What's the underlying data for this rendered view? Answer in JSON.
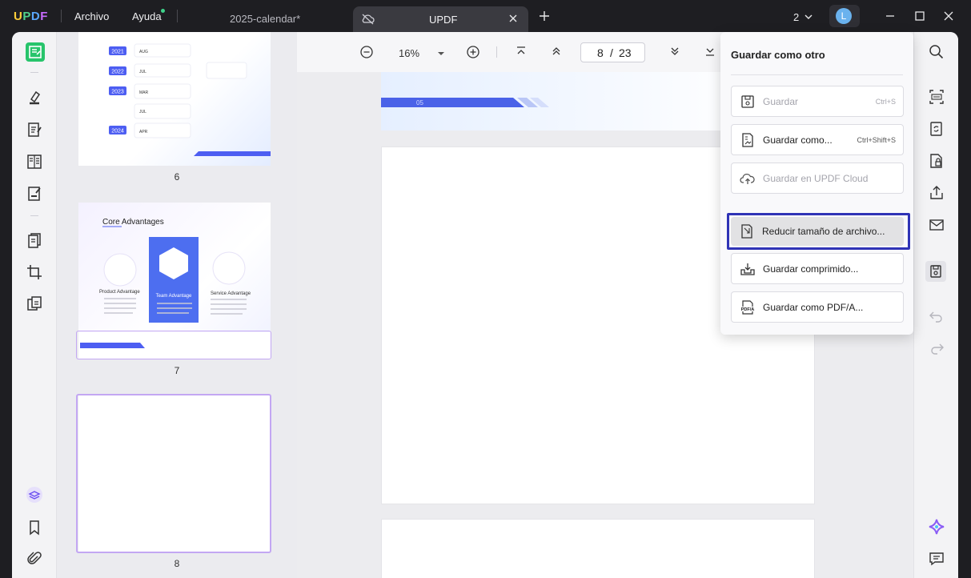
{
  "app": {
    "logo": "UPDF"
  },
  "titlebar": {
    "menu": {
      "file": "Archivo",
      "help": "Ayuda"
    },
    "tabs": [
      {
        "label": "2025-calendar*",
        "active": false
      },
      {
        "label": "UPDF",
        "active": true
      }
    ],
    "open_count": "2",
    "avatar_initial": "L"
  },
  "toolbar": {
    "zoom": "16%",
    "current_page": "8",
    "page_separator": "/",
    "total_pages": "23"
  },
  "thumbnails": {
    "pages": [
      {
        "number": "6"
      },
      {
        "number": "7",
        "title": "Core Advantages",
        "labels": [
          "Product Advantage",
          "Team Advantage",
          "Service Advantage"
        ]
      },
      {
        "number": "8"
      }
    ],
    "page6_timeline": {
      "years": [
        "2021",
        "2022",
        "2023",
        "2024"
      ],
      "months": [
        "AUG",
        "JUL",
        "MAR",
        "JUL",
        "APR"
      ]
    }
  },
  "document": {
    "page_top_label": "05"
  },
  "save_menu": {
    "title": "Guardar como otro",
    "items": [
      {
        "label": "Guardar",
        "shortcut": "Ctrl+S",
        "disabled": true,
        "icon": "save-icon"
      },
      {
        "label": "Guardar como...",
        "shortcut": "Ctrl+Shift+S",
        "disabled": false,
        "icon": "save-as-icon"
      },
      {
        "label": "Guardar en UPDF Cloud",
        "shortcut": "",
        "disabled": true,
        "icon": "cloud-upload-icon"
      },
      {
        "label": "Reducir tamaño de archivo...",
        "shortcut": "",
        "disabled": false,
        "highlighted": true,
        "icon": "reduce-size-icon"
      },
      {
        "label": "Guardar comprimido...",
        "shortcut": "",
        "disabled": false,
        "icon": "compress-icon"
      },
      {
        "label": "Guardar como PDF/A...",
        "shortcut": "",
        "disabled": false,
        "icon": "pdfa-icon"
      }
    ]
  },
  "colors": {
    "accent_green": "#27c46b",
    "highlight_border": "#2f33b6",
    "thumb_selected": "#b894f0"
  }
}
